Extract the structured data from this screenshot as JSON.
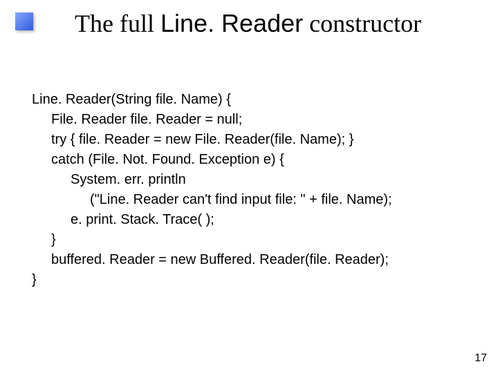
{
  "title": {
    "part1": "The full ",
    "part2": "Line. Reader",
    "part3": " constructor"
  },
  "code": {
    "l1": "Line. Reader(String file. Name) {",
    "l2": "File. Reader file. Reader = null;",
    "l3": "try { file. Reader = new File. Reader(file. Name); }",
    "l4": "catch (File. Not. Found. Exception e) {",
    "l5": "System. err. println",
    "l6": "(\"Line. Reader can't find input file: \" + file. Name);",
    "l7": "e. print. Stack. Trace( );",
    "l8": "}",
    "l9": "buffered. Reader = new Buffered. Reader(file. Reader);",
    "l10": "}"
  },
  "page_number": "17"
}
